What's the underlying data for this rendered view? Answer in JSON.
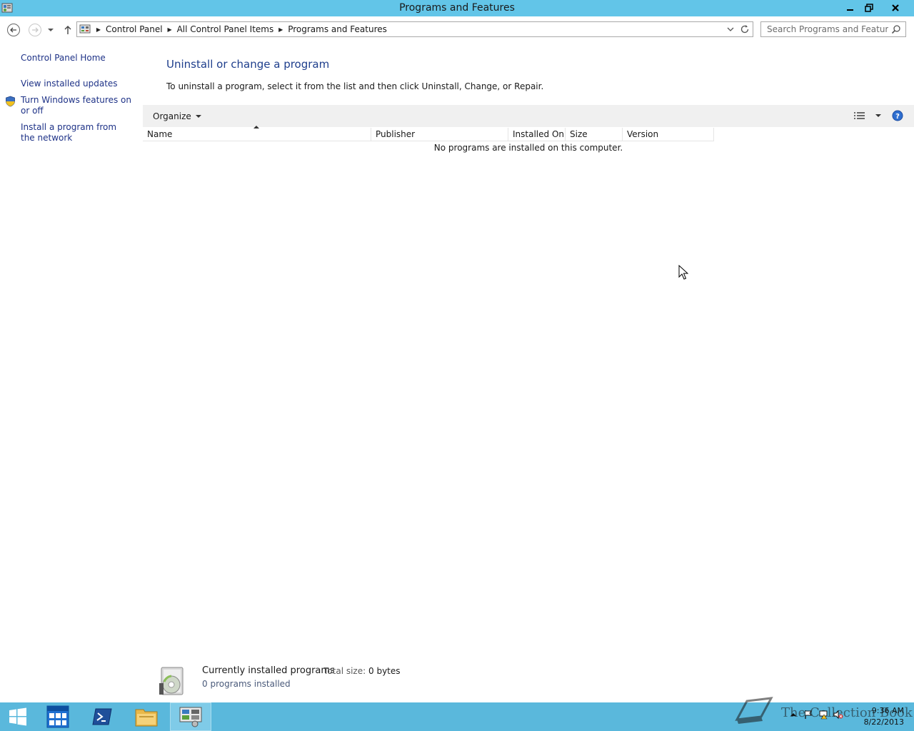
{
  "window": {
    "title": "Programs and Features"
  },
  "address": {
    "crumbs": [
      "Control Panel",
      "All Control Panel Items",
      "Programs and Features"
    ]
  },
  "search": {
    "placeholder": "Search Programs and Features"
  },
  "sidebar": {
    "home": "Control Panel Home",
    "links": [
      "View installed updates",
      "Turn Windows features on or off",
      "Install a program from the network"
    ]
  },
  "main": {
    "heading": "Uninstall or change a program",
    "instruction": "To uninstall a program, select it from the list and then click Uninstall, Change, or Repair.",
    "toolbar": {
      "organize": "Organize"
    },
    "columns": [
      "Name",
      "Publisher",
      "Installed On",
      "Size",
      "Version"
    ],
    "empty_message": "No programs are installed on this computer."
  },
  "details": {
    "title": "Currently installed programs",
    "size_label": "Total size:",
    "size_value": "0 bytes",
    "count": "0 programs installed"
  },
  "taskbar": {
    "watermark": "The Collection Book",
    "time": "9:36 AM",
    "date": "8/22/2013"
  },
  "colors": {
    "titlebar": "#62c5e8",
    "taskbar": "#5ab8dc",
    "link": "#1e3287",
    "heading": "#1e3e8c"
  },
  "icons": [
    "app-icon",
    "minimize-icon",
    "maximize-icon",
    "close-icon",
    "back-arrow-icon",
    "forward-arrow-icon",
    "up-arrow-icon",
    "refresh-icon",
    "search-icon",
    "shield-icon",
    "view-icon",
    "help-icon",
    "programs-icon",
    "start-icon",
    "server-manager-icon",
    "powershell-icon",
    "explorer-icon",
    "control-panel-icon"
  ]
}
